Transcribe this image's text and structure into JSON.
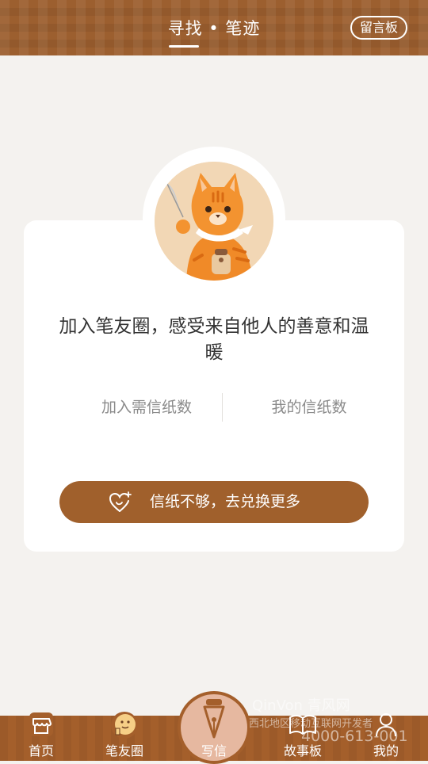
{
  "header": {
    "title": "寻找 • 笔迹",
    "board_label": "留言板"
  },
  "card": {
    "headline": "加入笔友圈，感受来自他人的善意和温暖",
    "stat_left": "加入需信纸数",
    "stat_right": "我的信纸数",
    "button_label": "信纸不够，去兑换更多",
    "button_icon": "heart-plus-icon"
  },
  "nav": {
    "items": [
      {
        "label": "首页",
        "icon": "store-icon"
      },
      {
        "label": "笔友圈",
        "icon": "thumbs-up-face-icon"
      },
      {
        "label": "写信",
        "icon": "fountain-pen-icon"
      },
      {
        "label": "故事板",
        "icon": "open-book-icon"
      },
      {
        "label": "我的",
        "icon": "person-icon"
      }
    ]
  },
  "watermark": {
    "brand": "QinVon 青风网",
    "line1": "西北地区移动互联网开发者",
    "line2": "4000-613-001"
  },
  "colors": {
    "brand_brown": "#9c5f2f",
    "button_brown": "#a0602c",
    "background": "#f4f2ef",
    "card": "#ffffff"
  }
}
